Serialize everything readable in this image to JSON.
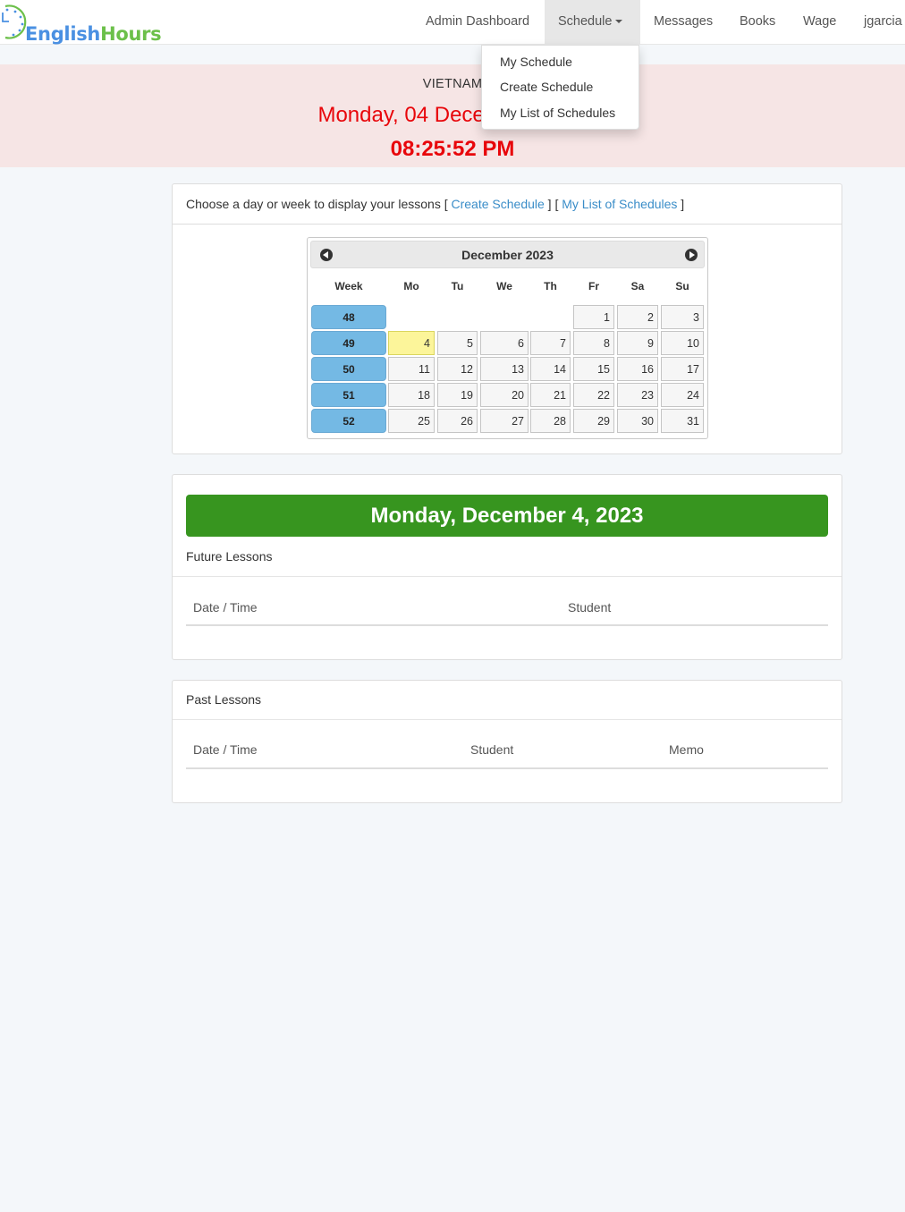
{
  "brand": {
    "part1": "English",
    "part2": "Hours"
  },
  "nav": {
    "items": [
      "Admin Dashboard",
      "Schedule",
      "Messages",
      "Books",
      "Wage",
      "jgarcia"
    ],
    "active": "Schedule"
  },
  "dropdown": {
    "items": [
      "My Schedule",
      "Create Schedule",
      "My List of Schedules"
    ]
  },
  "banner": {
    "country": "VIETNAM",
    "date": "Monday, 04 December 2023",
    "time": "08:25:52 PM"
  },
  "chooser": {
    "prefix": "Choose a day or week to display your lessons [ ",
    "link1": "Create Schedule",
    "middle": " ] [ ",
    "link2": "My List of Schedules",
    "suffix": " ]"
  },
  "calendar": {
    "title": "December 2023",
    "headers": [
      "Week",
      "Mo",
      "Tu",
      "We",
      "Th",
      "Fr",
      "Sa",
      "Su"
    ],
    "weeks": [
      {
        "week": "48",
        "days": [
          "",
          "",
          "",
          "",
          "1",
          "2",
          "3"
        ]
      },
      {
        "week": "49",
        "days": [
          "4",
          "5",
          "6",
          "7",
          "8",
          "9",
          "10"
        ]
      },
      {
        "week": "50",
        "days": [
          "11",
          "12",
          "13",
          "14",
          "15",
          "16",
          "17"
        ]
      },
      {
        "week": "51",
        "days": [
          "18",
          "19",
          "20",
          "21",
          "22",
          "23",
          "24"
        ]
      },
      {
        "week": "52",
        "days": [
          "25",
          "26",
          "27",
          "28",
          "29",
          "30",
          "31"
        ]
      }
    ],
    "today": "4"
  },
  "selected_day": "Monday, December 4, 2023",
  "future": {
    "title": "Future Lessons",
    "columns": [
      "Date / Time",
      "Student"
    ]
  },
  "past": {
    "title": "Past Lessons",
    "columns": [
      "Date / Time",
      "Student",
      "Memo"
    ]
  },
  "colors": {
    "accent": "#3a8dc8",
    "banner_text": "#e8060b",
    "week_cell": "#74b9e4",
    "today_cell": "#fcf59a",
    "day_header": "#37951f"
  }
}
